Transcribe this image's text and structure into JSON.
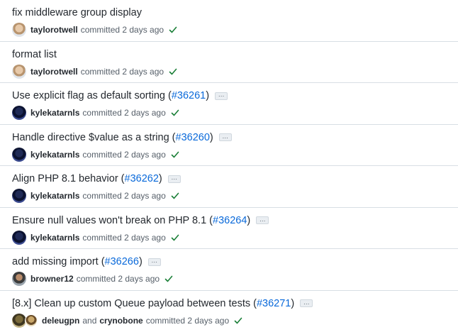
{
  "commits": [
    {
      "title": "fix middleware group display",
      "pr": "",
      "authors": [
        "taylorotwell"
      ],
      "avatar": "taylor",
      "meta": "committed 2 days ago",
      "has_ellipsis": false
    },
    {
      "title": "format list",
      "pr": "",
      "authors": [
        "taylorotwell"
      ],
      "avatar": "taylor",
      "meta": "committed 2 days ago",
      "has_ellipsis": false
    },
    {
      "title": "Use explicit flag as default sorting (",
      "pr": "#36261",
      "authors": [
        "kylekatarnls"
      ],
      "avatar": "kyle",
      "meta": "committed 2 days ago",
      "has_ellipsis": true
    },
    {
      "title": "Handle directive $value as a string (",
      "pr": "#36260",
      "authors": [
        "kylekatarnls"
      ],
      "avatar": "kyle",
      "meta": "committed 2 days ago",
      "has_ellipsis": true
    },
    {
      "title": "Align PHP 8.1 behavior (",
      "pr": "#36262",
      "authors": [
        "kylekatarnls"
      ],
      "avatar": "kyle",
      "meta": "committed 2 days ago",
      "has_ellipsis": true
    },
    {
      "title": "Ensure null values won't break on PHP 8.1 (",
      "pr": "#36264",
      "authors": [
        "kylekatarnls"
      ],
      "avatar": "kyle",
      "meta": "committed 2 days ago",
      "has_ellipsis": true
    },
    {
      "title": "add missing import (",
      "pr": "#36266",
      "authors": [
        "browner12"
      ],
      "avatar": "browner",
      "meta": "committed 2 days ago",
      "has_ellipsis": true
    },
    {
      "title": "[8.x] Clean up custom Queue payload between tests (",
      "pr": "#36271",
      "authors": [
        "deleugpn",
        "crynobone"
      ],
      "avatar": "deleu",
      "coauthor_avatar": "cryno",
      "and_text": "and",
      "meta": "committed 2 days ago",
      "has_ellipsis": true
    }
  ],
  "paren_close": ")",
  "ellipsis_label": "…",
  "check_color": "#1a7f37",
  "link_color": "#0969da"
}
